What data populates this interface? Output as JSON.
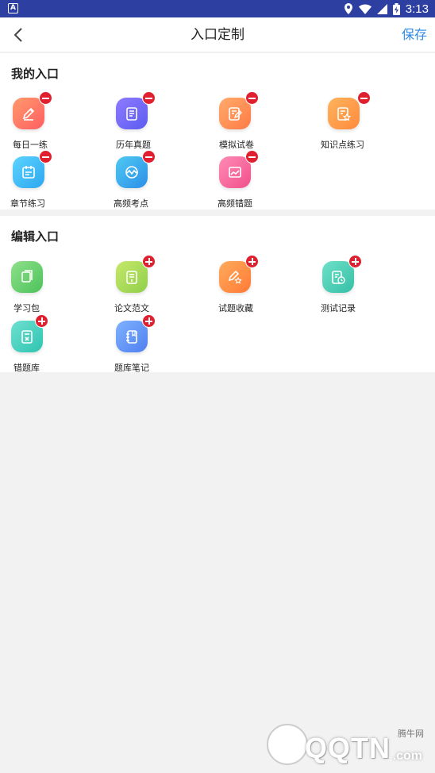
{
  "status_bar": {
    "time": "3:13",
    "notif_letter": "A"
  },
  "navbar": {
    "title": "入口定制",
    "save_label": "保存"
  },
  "my_entries": {
    "title": "我的入口",
    "items": [
      {
        "label": "每日一练",
        "icon": "pencil-icon",
        "color_from": "#ff9a6b",
        "color_to": "#ff5e62",
        "action": "remove"
      },
      {
        "label": "历年真题",
        "icon": "document-list-icon",
        "color_from": "#8f7bff",
        "color_to": "#5b5bf0",
        "action": "remove"
      },
      {
        "label": "模拟试卷",
        "icon": "edit-paper-icon",
        "color_from": "#ffab6b",
        "color_to": "#ff7a45",
        "action": "remove"
      },
      {
        "label": "知识点练习",
        "icon": "star-document-icon",
        "color_from": "#ffb35c",
        "color_to": "#ff8a3d",
        "action": "remove"
      },
      {
        "label": "章节练习",
        "icon": "calendar-list-icon",
        "color_from": "#5cd3ff",
        "color_to": "#2ea7f0",
        "action": "remove"
      },
      {
        "label": "高频考点",
        "icon": "pulse-chart-icon",
        "color_from": "#4fc9f2",
        "color_to": "#2b8fe8",
        "action": "remove"
      },
      {
        "label": "高频错题",
        "icon": "error-chart-icon",
        "color_from": "#ff8bb5",
        "color_to": "#f0508a",
        "action": "remove"
      }
    ]
  },
  "edit_entries": {
    "title": "编辑入口",
    "items": [
      {
        "label": "学习包",
        "icon": "books-icon",
        "color_from": "#8fe08a",
        "color_to": "#4cc25a",
        "action": "add"
      },
      {
        "label": "论文范文",
        "icon": "essay-document-icon",
        "color_from": "#c6e86a",
        "color_to": "#8fcf4a",
        "action": "add"
      },
      {
        "label": "试题收藏",
        "icon": "favorite-pencil-icon",
        "color_from": "#ffab5c",
        "color_to": "#ff7a35",
        "action": "add"
      },
      {
        "label": "测试记录",
        "icon": "clock-document-icon",
        "color_from": "#6fe0c8",
        "color_to": "#35c0a6",
        "action": "add"
      },
      {
        "label": "错题库",
        "icon": "wrong-document-icon",
        "color_from": "#6fe0d0",
        "color_to": "#2ec4b0",
        "action": "add"
      },
      {
        "label": "题库笔记",
        "icon": "notebook-icon",
        "color_from": "#7fb2ff",
        "color_to": "#4f7ff0",
        "action": "add"
      }
    ]
  },
  "watermark": {
    "brand": "QQTN",
    "suffix": ".com",
    "cn_name": "腾牛网"
  }
}
